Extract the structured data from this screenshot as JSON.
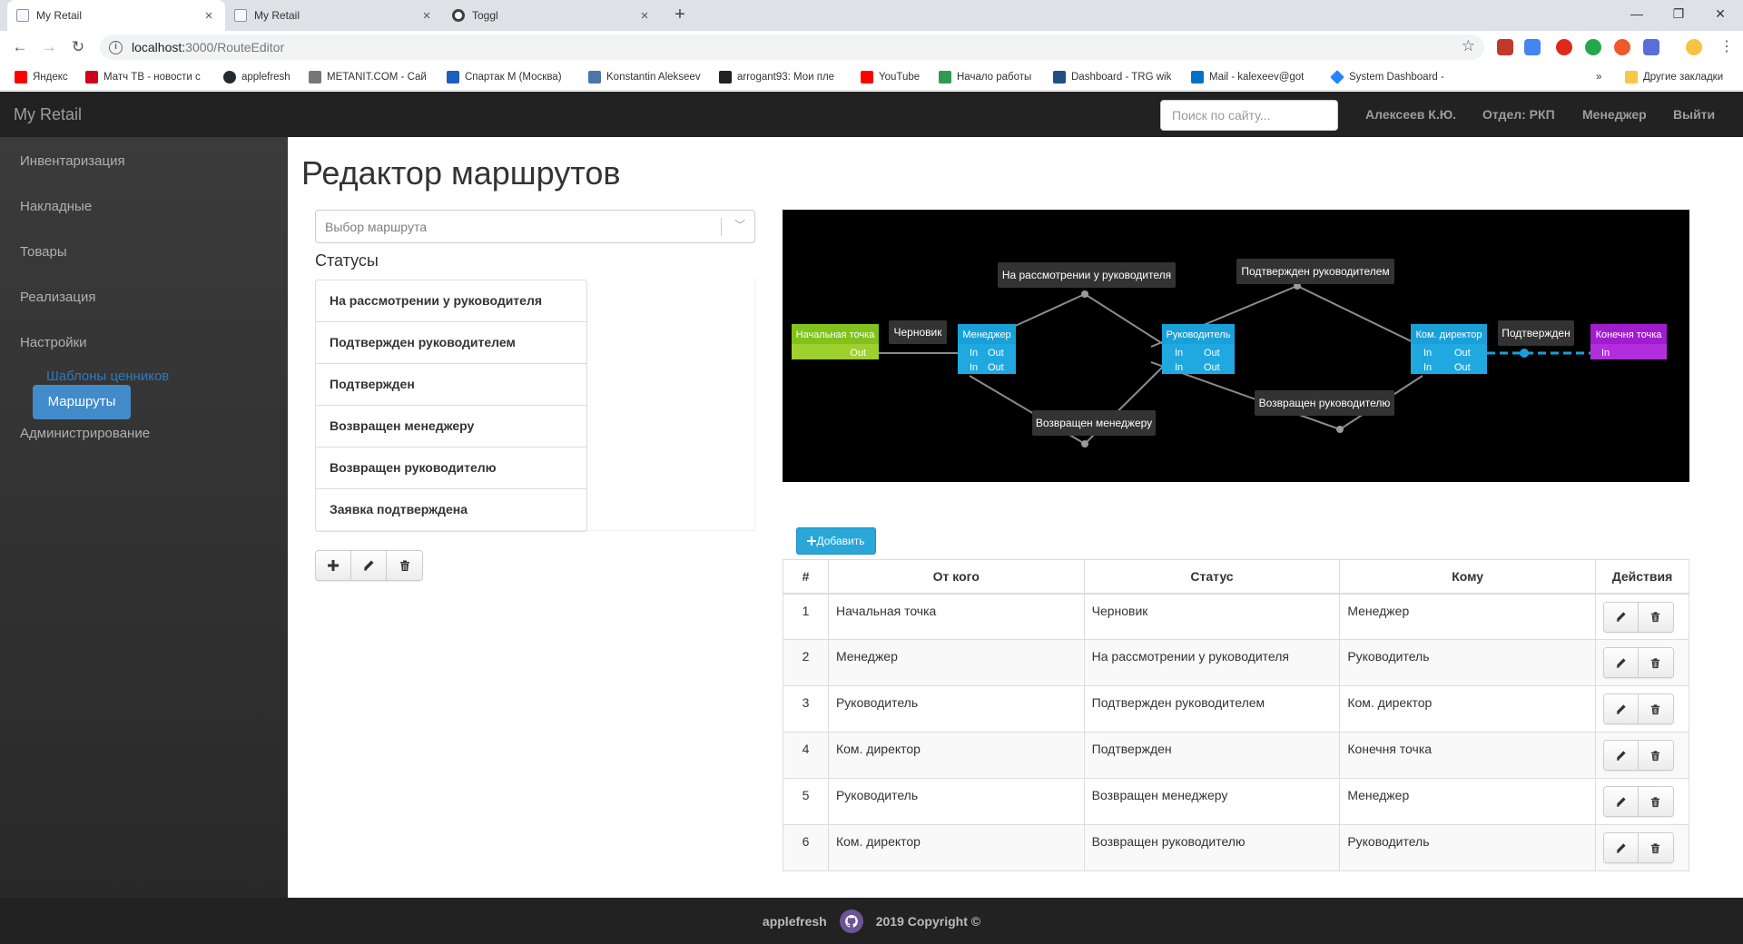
{
  "browser": {
    "tabs": [
      {
        "title": "My Retail",
        "icon": "page-icon",
        "active": true
      },
      {
        "title": "My Retail",
        "icon": "page-icon",
        "active": false
      },
      {
        "title": "Toggl",
        "icon": "toggl-icon",
        "active": false
      }
    ],
    "new_tab": "+",
    "window_controls": {
      "minimize": "—",
      "maximize": "❐",
      "close": "✕"
    },
    "url_host": "localhost:",
    "url_path": "3000/RouteEditor",
    "bookmarks": [
      {
        "label": "Яндекс",
        "color": "#ff0000"
      },
      {
        "label": "Матч ТВ - новости с",
        "color": "#d0021b"
      },
      {
        "label": "applefresh",
        "color": "#24292e"
      },
      {
        "label": "METANIT.COM - Сай",
        "color": "#777777"
      },
      {
        "label": "Спартак М (Москва)",
        "color": "#1d5fbf"
      },
      {
        "label": "Konstantin Alekseev",
        "color": "#4a76a8"
      },
      {
        "label": "arrogant93: Мои пле",
        "color": "#222222"
      },
      {
        "label": "YouTube",
        "color": "#ff0000"
      },
      {
        "label": "Начало работы",
        "color": "#2e9c50"
      },
      {
        "label": "Dashboard - TRG wik",
        "color": "#205081"
      },
      {
        "label": "Mail - kalexeev@got",
        "color": "#0072c6"
      },
      {
        "label": "System Dashboard -",
        "color": "#2684ff"
      }
    ],
    "bookmarks_more": "»",
    "other_bookmarks": "Другие закладки"
  },
  "app": {
    "brand": "My Retail",
    "search_placeholder": "Поиск по сайту...",
    "user": "Алексеев К.Ю.",
    "department": "Отдел: РКП",
    "role": "Менеджер",
    "logout": "Выйти"
  },
  "sidebar": {
    "items": [
      "Инвентаризация",
      "Накладные",
      "Товары",
      "Реализация",
      "Настройки"
    ],
    "sub_items": [
      "Шаблоны ценников",
      "Маршруты"
    ],
    "last_item": "Администрирование"
  },
  "main": {
    "title": "Редактор маршрутов",
    "route_select_placeholder": "Выбор маршрута",
    "statuses_heading": "Статусы",
    "statuses": [
      "На рассмотрении у руководителя",
      "Подтвержден руководителем",
      "Подтвержден",
      "Возвращен менеджеру",
      "Возвращен руководителю",
      "Заявка подтверждена"
    ],
    "add_button": "Добавить"
  },
  "graph": {
    "nodes": {
      "start": {
        "title": "Начальная точка",
        "port": "Out",
        "color": "#7fc31c"
      },
      "manager": {
        "title": "Менеджер",
        "ports": [
          "In",
          "Out",
          "In",
          "Out"
        ],
        "color": "#1aa0d8"
      },
      "head": {
        "title": "Руководитель",
        "ports": [
          "In",
          "Out",
          "In",
          "Out"
        ],
        "color": "#1aa0d8"
      },
      "director": {
        "title": "Ком. директор",
        "ports": [
          "In",
          "Out",
          "In",
          "Out"
        ],
        "color": "#1aa0d8"
      },
      "end": {
        "title": "Конечня точка",
        "port": "In",
        "color": "#a11cce"
      }
    },
    "edge_labels": [
      "Черновик",
      "На рассмотрении у руководителя",
      "Подтвержден руководителем",
      "Подтвержден",
      "Возвращен менеджеру",
      "Возвращен руководителю"
    ]
  },
  "table": {
    "headers": [
      "#",
      "От кого",
      "Статус",
      "Кому",
      "Действия"
    ],
    "rows": [
      {
        "n": "1",
        "from": "Начальная точка",
        "status": "Черновик",
        "to": "Менеджер"
      },
      {
        "n": "2",
        "from": "Менеджер",
        "status": "На рассмотрении у руководителя",
        "to": "Руководитель"
      },
      {
        "n": "3",
        "from": "Руководитель",
        "status": "Подтвержден руководителем",
        "to": "Ком. директор"
      },
      {
        "n": "4",
        "from": "Ком. директор",
        "status": "Подтвержден",
        "to": "Конечня точка"
      },
      {
        "n": "5",
        "from": "Руководитель",
        "status": "Возвращен менеджеру",
        "to": "Менеджер"
      },
      {
        "n": "6",
        "from": "Ком. директор",
        "status": "Возвращен руководителю",
        "to": "Руководитель"
      }
    ]
  },
  "footer": {
    "author": "applefresh",
    "copyright": "2019 Copyright ©"
  }
}
